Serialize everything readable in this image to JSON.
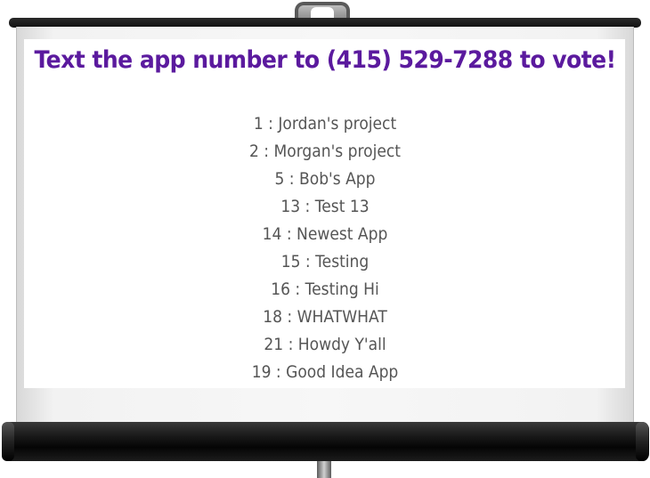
{
  "headline": "Text the app number to (415) 529-7288 to vote!",
  "apps": [
    "1 : Jordan's project",
    "2 : Morgan's project",
    "5 : Bob's App",
    "13 : Test 13",
    "14 : Newest App",
    "15 : Testing",
    "16 : Testing Hi",
    "18 : WHATWHAT",
    "21 : Howdy Y'all",
    "19 : Good Idea App"
  ],
  "colors": {
    "headline": "#5b1a9e",
    "list_text": "#555555",
    "roller": "#111111"
  }
}
